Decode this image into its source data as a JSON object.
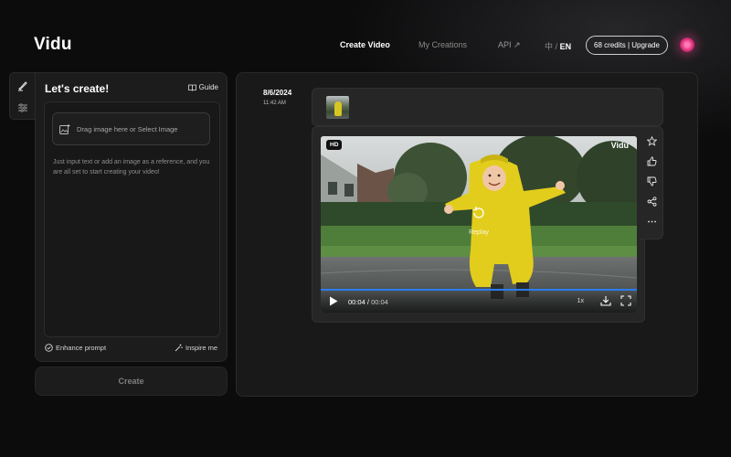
{
  "header": {
    "logo": "Vidu",
    "nav": {
      "create_video": "Create Video",
      "my_creations": "My Creations",
      "api": "API ↗",
      "lang_zh": "中",
      "lang_sep": "/",
      "lang_en": "EN"
    },
    "credits_button": "68 credits | Upgrade"
  },
  "left_panel": {
    "title": "Let's create!",
    "guide_label": "Guide",
    "upload_label": "Drag image here or Select Image",
    "hint": "Just input text or add an image as a reference, and you are all set to start creating your video!",
    "enhance_label": "Enhance prompt",
    "inspire_label": "Inspire me",
    "create_label": "Create"
  },
  "result": {
    "date": "8/6/2024",
    "time": "11:42 AM",
    "video": {
      "badge": "HD",
      "watermark": "Vidu",
      "replay_label": "Replay",
      "current_time": "00:04",
      "time_sep": "/",
      "duration": "00:04",
      "speed": "1x",
      "progress": 1.0
    }
  },
  "icons": {
    "rail": [
      "brush-icon",
      "sliders-icon"
    ],
    "side_actions": [
      "star-icon",
      "thumbs-up-icon",
      "thumbs-down-icon",
      "share-icon",
      "more-icon"
    ]
  },
  "colors": {
    "background": "#0c0c0d",
    "panel": "#1c1c1d",
    "progress": "#2a7cf6",
    "raincoat": "#e2cd1c"
  }
}
